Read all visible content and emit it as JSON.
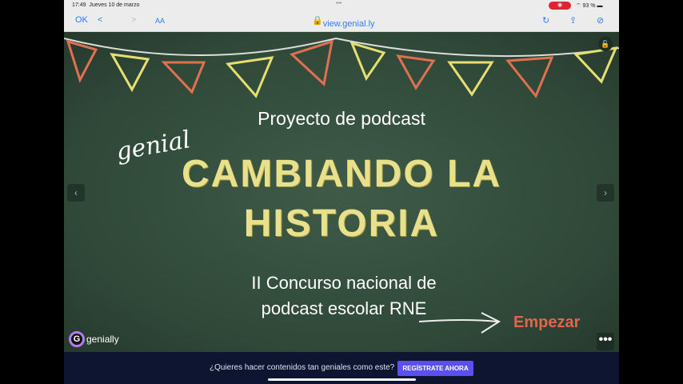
{
  "status": {
    "time": "17:49",
    "date": "Jueves 10 de marzo",
    "battery": "93 %"
  },
  "browser": {
    "done": "OK",
    "back": "<",
    "forward": ">",
    "text_size": "AA",
    "url": "view.genial.ly"
  },
  "slide": {
    "subtitle": "Proyecto de podcast",
    "brand_word": "genial",
    "title_line1": "CAMBIANDO LA",
    "title_line2": "HISTORIA",
    "contest_line1": "II Concurso nacional de",
    "contest_line2": "podcast escolar RNE",
    "start": "Empezar",
    "logo": "genially",
    "more": "•••"
  },
  "banner": {
    "question": "¿Quieres hacer contenidos tan geniales como este?",
    "cta": "REGÍSTRATE AHORA"
  },
  "colors": {
    "board": "#2f4838",
    "title": "#e8e08a",
    "accent": "#e4644a",
    "cta": "#5a4ff0"
  }
}
